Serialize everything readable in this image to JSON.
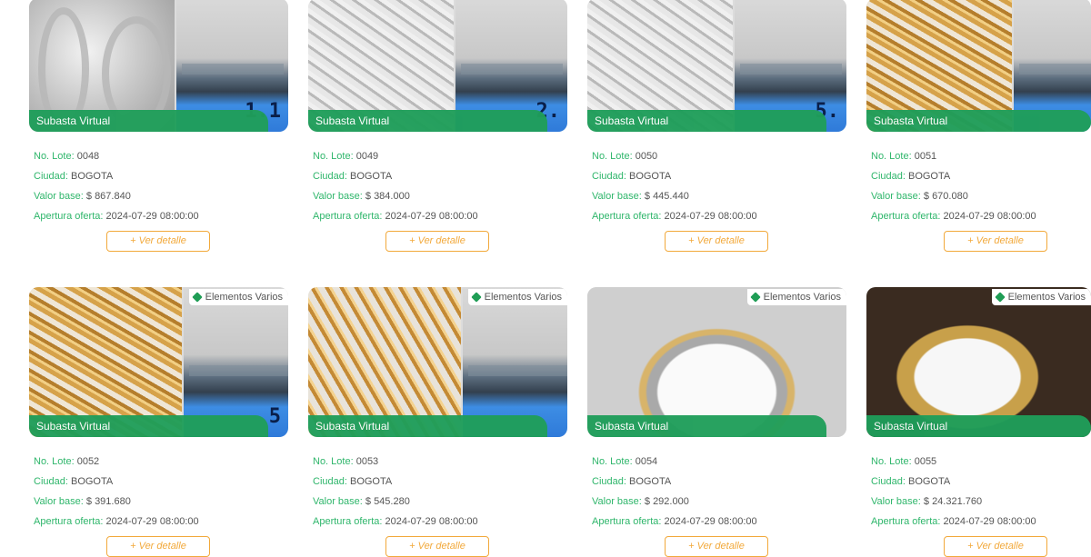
{
  "labels": {
    "badge": "Subasta Virtual",
    "lot": "No. Lote:",
    "city": "Ciudad:",
    "base": "Valor base:",
    "opening": "Apertura oferta:",
    "detail_button": "+ Ver detalle",
    "category_tag": "Elementos Varios"
  },
  "cards": [
    {
      "lot": "0048",
      "city": "BOGOTA",
      "base": "$ 867.840",
      "opening": "2024-07-29 08:00:00",
      "scale": "1.1",
      "theme": "silver"
    },
    {
      "lot": "0049",
      "city": "BOGOTA",
      "base": "$ 384.000",
      "opening": "2024-07-29 08:00:00",
      "scale": "2.",
      "theme": "silver2"
    },
    {
      "lot": "0050",
      "city": "BOGOTA",
      "base": "$ 445.440",
      "opening": "2024-07-29 08:00:00",
      "scale": "5.",
      "theme": "silver2"
    },
    {
      "lot": "0051",
      "city": "BOGOTA",
      "base": "$ 670.080",
      "opening": "2024-07-29 08:00:00",
      "scale": "",
      "theme": "gold"
    },
    {
      "lot": "0052",
      "city": "BOGOTA",
      "base": "$ 391.680",
      "opening": "2024-07-29 08:00:00",
      "scale": "5",
      "theme": "gold"
    },
    {
      "lot": "0053",
      "city": "BOGOTA",
      "base": "$ 545.280",
      "opening": "2024-07-29 08:00:00",
      "scale": "",
      "theme": "gold2"
    },
    {
      "lot": "0054",
      "city": "BOGOTA",
      "base": "$ 292.000",
      "opening": "2024-07-29 08:00:00",
      "scale": "",
      "theme": "watch1"
    },
    {
      "lot": "0055",
      "city": "BOGOTA",
      "base": "$ 24.321.760",
      "opening": "2024-07-29 08:00:00",
      "scale": "",
      "theme": "watch2"
    }
  ]
}
